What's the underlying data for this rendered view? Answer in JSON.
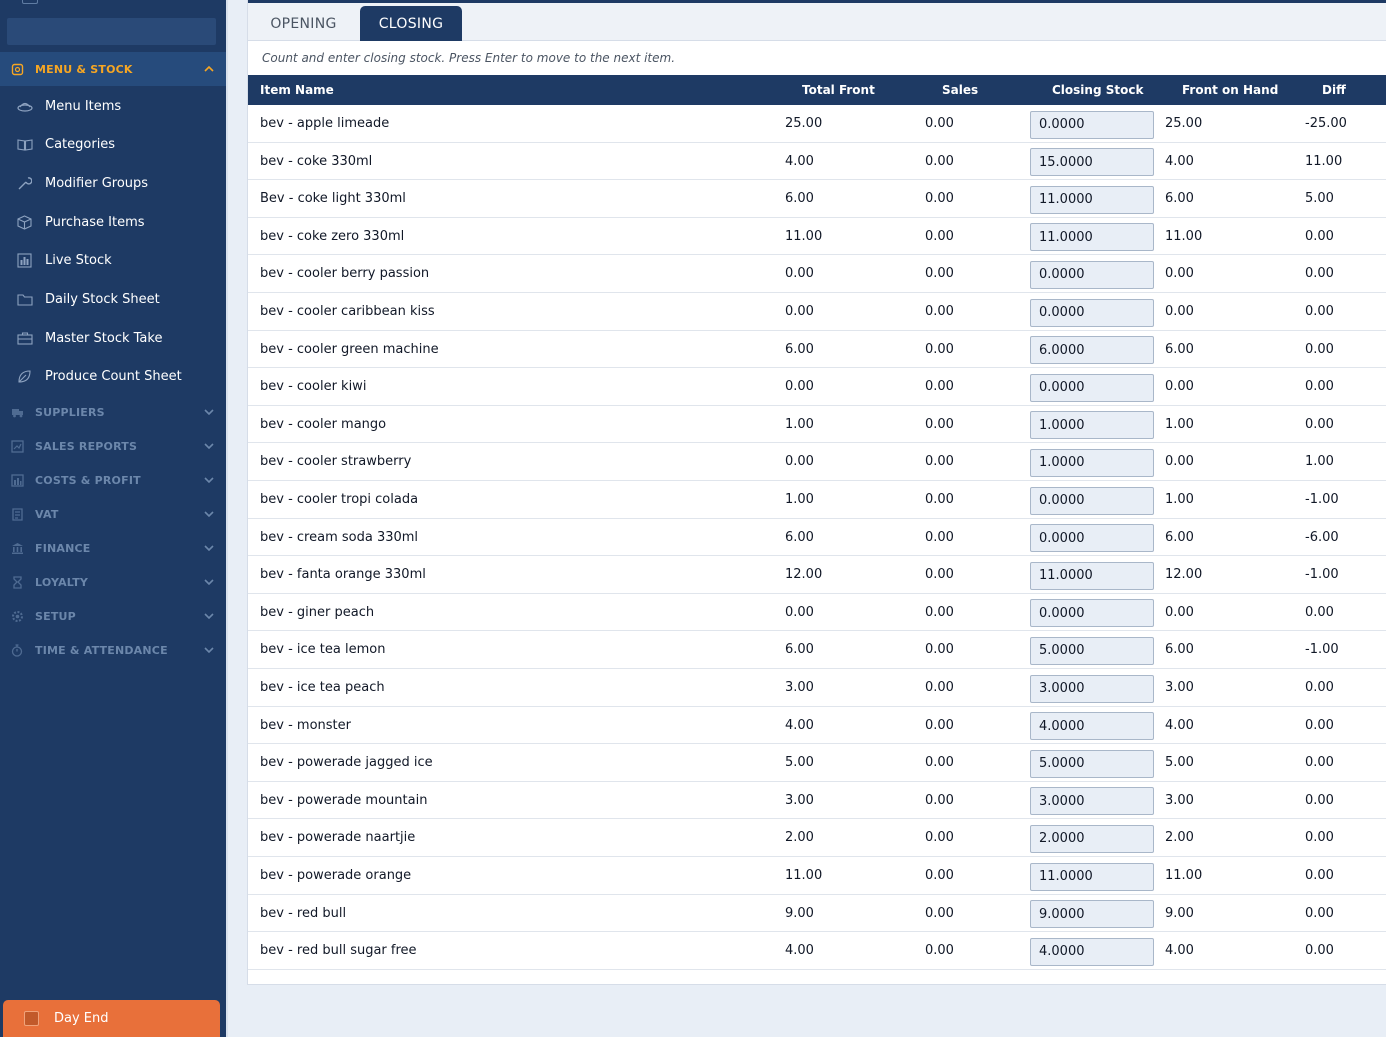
{
  "sidebar": {
    "active_section": {
      "label": "MENU & STOCK",
      "icon": "menu-stock-icon"
    },
    "menu_items": [
      {
        "label": "Menu Items",
        "icon": "tray-icon"
      },
      {
        "label": "Categories",
        "icon": "book-icon"
      },
      {
        "label": "Modifier Groups",
        "icon": "wrench-icon"
      },
      {
        "label": "Purchase Items",
        "icon": "box-icon"
      },
      {
        "label": "Live Stock",
        "icon": "bar-chart-icon"
      },
      {
        "label": "Daily Stock Sheet",
        "icon": "folder-icon"
      },
      {
        "label": "Master Stock Take",
        "icon": "briefcase-icon"
      },
      {
        "label": "Produce Count Sheet",
        "icon": "leaf-icon"
      }
    ],
    "sections": [
      {
        "label": "SUPPLIERS",
        "icon": "truck-icon"
      },
      {
        "label": "SALES REPORTS",
        "icon": "report-icon"
      },
      {
        "label": "COSTS & PROFIT",
        "icon": "chart-icon"
      },
      {
        "label": "VAT",
        "icon": "receipt-icon"
      },
      {
        "label": "FINANCE",
        "icon": "bank-icon"
      },
      {
        "label": "LOYALTY",
        "icon": "award-icon"
      },
      {
        "label": "SETUP",
        "icon": "gear-icon"
      },
      {
        "label": "TIME & ATTENDANCE",
        "icon": "stopwatch-icon"
      }
    ],
    "day_end": {
      "label": "Day End",
      "icon": "calendar-icon"
    }
  },
  "tabs": {
    "opening": "OPENING",
    "closing": "CLOSING",
    "active": "closing"
  },
  "instructions": "Count and enter closing stock. Press Enter to move to the next item.",
  "table": {
    "headers": {
      "item_name": "Item Name",
      "total_front": "Total Front",
      "sales": "Sales",
      "closing_stock": "Closing Stock",
      "front_on_hand": "Front on Hand",
      "diff": "Diff"
    },
    "rows": [
      {
        "name": "bev - apple limeade",
        "total_front": "25.00",
        "sales": "0.00",
        "closing": "0.0000",
        "on_hand": "25.00",
        "diff": "-25.00"
      },
      {
        "name": "bev - coke 330ml",
        "total_front": "4.00",
        "sales": "0.00",
        "closing": "15.0000",
        "on_hand": "4.00",
        "diff": "11.00"
      },
      {
        "name": "Bev - coke light 330ml",
        "total_front": "6.00",
        "sales": "0.00",
        "closing": "11.0000",
        "on_hand": "6.00",
        "diff": "5.00"
      },
      {
        "name": "bev - coke zero 330ml",
        "total_front": "11.00",
        "sales": "0.00",
        "closing": "11.0000",
        "on_hand": "11.00",
        "diff": "0.00"
      },
      {
        "name": "bev - cooler berry passion",
        "total_front": "0.00",
        "sales": "0.00",
        "closing": "0.0000",
        "on_hand": "0.00",
        "diff": "0.00"
      },
      {
        "name": "bev - cooler caribbean kiss",
        "total_front": "0.00",
        "sales": "0.00",
        "closing": "0.0000",
        "on_hand": "0.00",
        "diff": "0.00"
      },
      {
        "name": "bev - cooler green machine",
        "total_front": "6.00",
        "sales": "0.00",
        "closing": "6.0000",
        "on_hand": "6.00",
        "diff": "0.00"
      },
      {
        "name": "bev - cooler kiwi",
        "total_front": "0.00",
        "sales": "0.00",
        "closing": "0.0000",
        "on_hand": "0.00",
        "diff": "0.00"
      },
      {
        "name": "bev - cooler mango",
        "total_front": "1.00",
        "sales": "0.00",
        "closing": "1.0000",
        "on_hand": "1.00",
        "diff": "0.00"
      },
      {
        "name": "bev - cooler strawberry",
        "total_front": "0.00",
        "sales": "0.00",
        "closing": "1.0000",
        "on_hand": "0.00",
        "diff": "1.00"
      },
      {
        "name": "bev - cooler tropi colada",
        "total_front": "1.00",
        "sales": "0.00",
        "closing": "0.0000",
        "on_hand": "1.00",
        "diff": "-1.00"
      },
      {
        "name": "bev - cream soda 330ml",
        "total_front": "6.00",
        "sales": "0.00",
        "closing": "0.0000",
        "on_hand": "6.00",
        "diff": "-6.00"
      },
      {
        "name": "bev - fanta orange 330ml",
        "total_front": "12.00",
        "sales": "0.00",
        "closing": "11.0000",
        "on_hand": "12.00",
        "diff": "-1.00"
      },
      {
        "name": "bev - giner peach",
        "total_front": "0.00",
        "sales": "0.00",
        "closing": "0.0000",
        "on_hand": "0.00",
        "diff": "0.00"
      },
      {
        "name": "bev - ice tea lemon",
        "total_front": "6.00",
        "sales": "0.00",
        "closing": "5.0000",
        "on_hand": "6.00",
        "diff": "-1.00"
      },
      {
        "name": "bev - ice tea peach",
        "total_front": "3.00",
        "sales": "0.00",
        "closing": "3.0000",
        "on_hand": "3.00",
        "diff": "0.00"
      },
      {
        "name": "bev - monster",
        "total_front": "4.00",
        "sales": "0.00",
        "closing": "4.0000",
        "on_hand": "4.00",
        "diff": "0.00"
      },
      {
        "name": "bev - powerade jagged ice",
        "total_front": "5.00",
        "sales": "0.00",
        "closing": "5.0000",
        "on_hand": "5.00",
        "diff": "0.00"
      },
      {
        "name": "bev - powerade mountain",
        "total_front": "3.00",
        "sales": "0.00",
        "closing": "3.0000",
        "on_hand": "3.00",
        "diff": "0.00"
      },
      {
        "name": "bev - powerade naartjie",
        "total_front": "2.00",
        "sales": "0.00",
        "closing": "2.0000",
        "on_hand": "2.00",
        "diff": "0.00"
      },
      {
        "name": "bev - powerade orange",
        "total_front": "11.00",
        "sales": "0.00",
        "closing": "11.0000",
        "on_hand": "11.00",
        "diff": "0.00"
      },
      {
        "name": "bev - red bull",
        "total_front": "9.00",
        "sales": "0.00",
        "closing": "9.0000",
        "on_hand": "9.00",
        "diff": "0.00"
      },
      {
        "name": "bev - red bull sugar free",
        "total_front": "4.00",
        "sales": "0.00",
        "closing": "4.0000",
        "on_hand": "4.00",
        "diff": "0.00"
      }
    ]
  },
  "colors": {
    "sidebar_bg": "#1e3a64",
    "accent_orange": "#f6a623",
    "day_end_bg": "#e8703a",
    "header_bg": "#1e3a64"
  }
}
